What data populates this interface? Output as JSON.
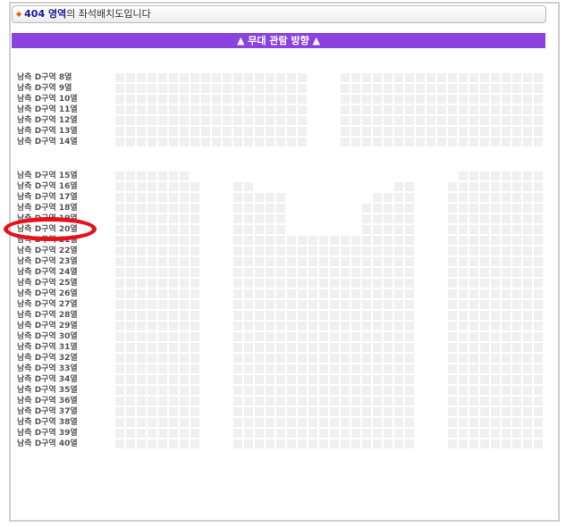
{
  "title": {
    "zone": "404 영역",
    "suffix": "의 좌석배치도입니다"
  },
  "stage": {
    "label": "▲ 무대 관람 방향 ▲"
  },
  "rows": [
    "남측 D구역 8열",
    "남측 D구역 9열",
    "남측 D구역 10열",
    "남측 D구역 11열",
    "남측 D구역 12열",
    "남측 D구역 13열",
    "남측 D구역 14열",
    "남측 D구역 15열",
    "남측 D구역 16열",
    "남측 D구역 17열",
    "남측 D구역 18열",
    "남측 D구역 19열",
    "남측 D구역 20열",
    "남측 D구역 21열",
    "남측 D구역 22열",
    "남측 D구역 23열",
    "남측 D구역 24열",
    "남측 D구역 25열",
    "남측 D구역 26열",
    "남측 D구역 27열",
    "남측 D구역 28열",
    "남측 D구역 29열",
    "남측 D구역 30열",
    "남측 D구역 31열",
    "남측 D구역 32열",
    "남측 D구역 33열",
    "남측 D구역 34열",
    "남측 D구역 35열",
    "남측 D구역 36열",
    "남측 D구역 37열",
    "남측 D구역 38열",
    "남측 D구역 39열",
    "남측 D구역 40열"
  ],
  "highlighted_row": "남측 D구역 20열",
  "colors": {
    "stage_bar": "#8c42e0",
    "highlight": "#e8101a",
    "seat": "#f0f0f0"
  }
}
